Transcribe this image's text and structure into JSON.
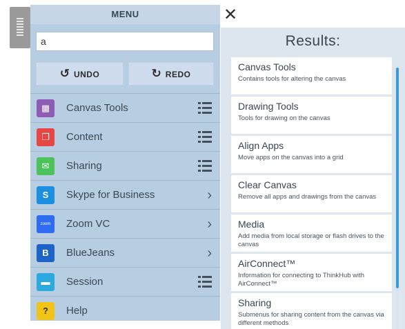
{
  "menu": {
    "title": "MENU",
    "search_value": "a",
    "undo_label": "UNDO",
    "redo_label": "REDO",
    "items": [
      {
        "label": "Canvas Tools",
        "icon": "canvas-tools-icon",
        "color": "#8e5bb5",
        "glyph": "▦",
        "action": "list"
      },
      {
        "label": "Content",
        "icon": "content-icon",
        "color": "#e84545",
        "glyph": "❐",
        "action": "list"
      },
      {
        "label": "Sharing",
        "icon": "sharing-icon",
        "color": "#4cc25a",
        "glyph": "✉",
        "action": "list"
      },
      {
        "label": "Skype for Business",
        "icon": "skype-icon",
        "color": "#1d8fe0",
        "glyph": "S",
        "action": "arrow"
      },
      {
        "label": "Zoom VC",
        "icon": "zoom-icon",
        "color": "#2d6cf0",
        "glyph": "zoom",
        "action": "arrow"
      },
      {
        "label": "BlueJeans",
        "icon": "bluejeans-icon",
        "color": "#1e63c7",
        "glyph": "B",
        "action": "arrow"
      },
      {
        "label": "Session",
        "icon": "session-icon",
        "color": "#2ca9df",
        "glyph": "▬",
        "action": "list"
      },
      {
        "label": "Help",
        "icon": "help-icon",
        "color": "#f0c419",
        "glyph": "?",
        "action": "none"
      }
    ]
  },
  "results": {
    "title": "Results:",
    "items": [
      {
        "title": "Canvas Tools",
        "desc": "Contains tools for altering the canvas"
      },
      {
        "title": "Drawing Tools",
        "desc": "Tools for drawing on the canvas"
      },
      {
        "title": "Align Apps",
        "desc": "Move apps on the canvas into a grid"
      },
      {
        "title": "Clear Canvas",
        "desc": "Remove all apps and drawings from the canvas"
      },
      {
        "title": "Media",
        "desc": "Add media from local storage or flash drives to the canvas"
      },
      {
        "title": "AirConnect™",
        "desc": "Information for connecting to ThinkHub with AirConnect™"
      },
      {
        "title": "Sharing",
        "desc": "Submenus for sharing content from the canvas via different methods"
      }
    ]
  },
  "close_glyph": "✕",
  "icons": {
    "undo": "undo-icon",
    "redo": "redo-icon",
    "close": "close-icon",
    "handle": "drag-handle-icon"
  }
}
